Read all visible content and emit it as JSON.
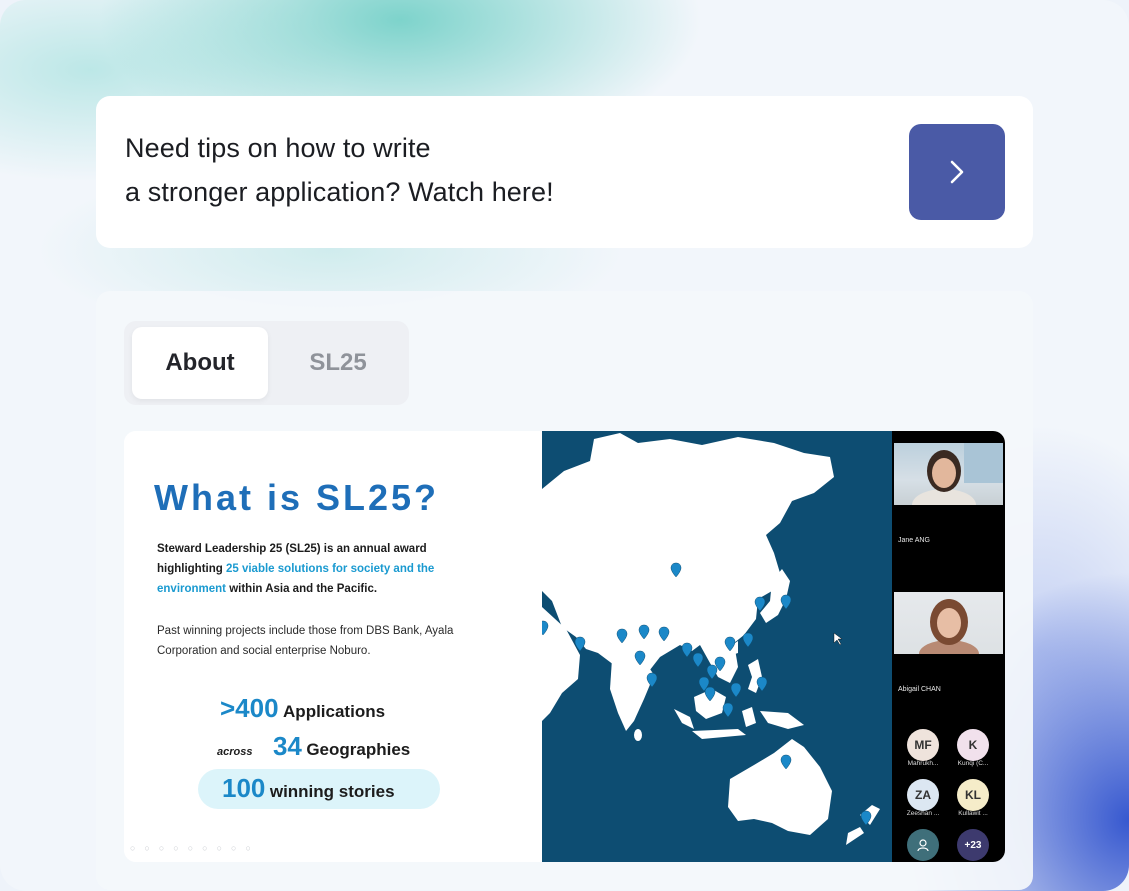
{
  "tip": {
    "text": "Need tips on how to write\na stronger application? Watch here!",
    "button_icon": "chevron-right-icon"
  },
  "tabs": [
    {
      "label": "About",
      "active": true
    },
    {
      "label": "SL25",
      "active": false
    }
  ],
  "slide": {
    "title": "What is SL25?",
    "desc_part1": "Steward Leadership 25 (SL25) is an annual award highlighting ",
    "desc_highlight": "25 viable solutions for society and the environment",
    "desc_part2": " within Asia and the Pacific.",
    "past": "Past winning projects include those from DBS Bank, Ayala Corporation and social enterprise Noburo.",
    "stat1_num": ">400",
    "stat1_label": "Applications",
    "stat2_prefix": "across",
    "stat2_num": "34",
    "stat2_label": "Geographies",
    "stat3_num": "100",
    "stat3_label": "winning stories"
  },
  "participants": {
    "cameras": [
      {
        "name": "Jane ANG"
      },
      {
        "name": "Abigail CHAN"
      }
    ],
    "avatars": [
      {
        "initials": "MF",
        "name": "Mahrukh...",
        "color": "#efe3dc"
      },
      {
        "initials": "K",
        "name": "Kunqi (C...",
        "color": "#f1e1ec"
      },
      {
        "initials": "ZA",
        "name": "Zeeshan ...",
        "color": "#dce7f2"
      },
      {
        "initials": "KL",
        "name": "Kullawit ...",
        "color": "#f5ecc9"
      }
    ],
    "more_count": "+23"
  },
  "colors": {
    "button": "#4a5aa6",
    "title": "#1e6eb8",
    "highlight": "#1a9ad0",
    "map_sea": "#0d4d72",
    "pin": "#1b88c8"
  }
}
